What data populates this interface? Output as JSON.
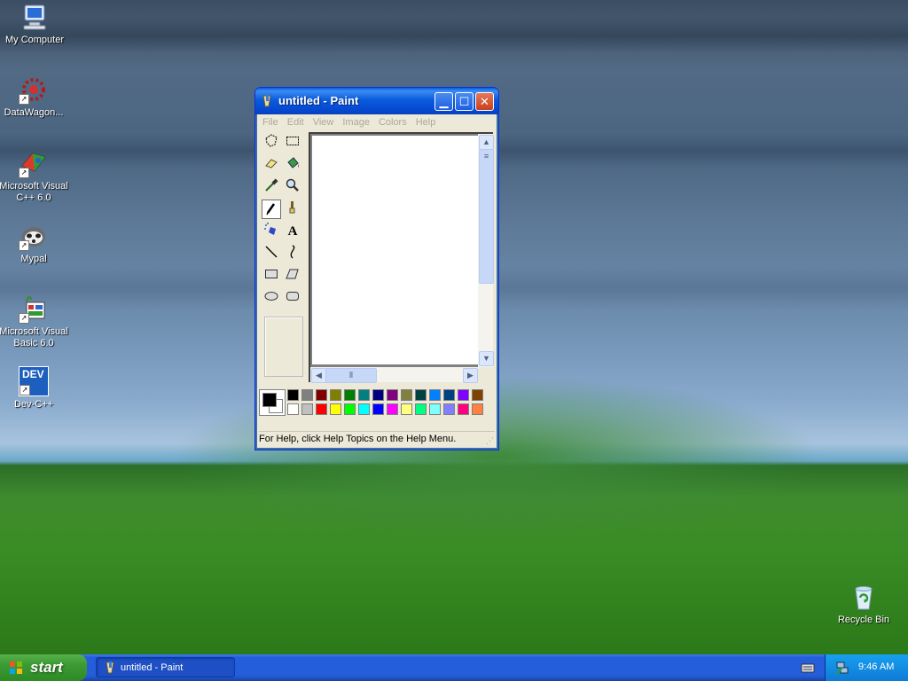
{
  "desktop": {
    "icons": [
      {
        "label": "My Computer",
        "icon": "my-computer-icon"
      },
      {
        "label": "DataWagon...",
        "icon": "datawagon-icon"
      },
      {
        "label": "Microsoft Visual C++ 6.0",
        "icon": "visual-cpp-icon"
      },
      {
        "label": "Mypal",
        "icon": "mypal-icon"
      },
      {
        "label": "Microsoft Visual Basic 6.0",
        "icon": "visual-basic-icon"
      },
      {
        "label": "Dev-C++",
        "icon": "dev-cpp-icon"
      }
    ],
    "recycle_bin": {
      "label": "Recycle Bin",
      "icon": "recycle-bin-icon"
    },
    "devcpp_badge": "DEV"
  },
  "paint_window": {
    "title": "untitled - Paint",
    "menu": [
      "File",
      "Edit",
      "View",
      "Image",
      "Colors",
      "Help"
    ],
    "tools": [
      "free-form-select",
      "select",
      "eraser",
      "fill-with-color",
      "pick-color",
      "magnifier",
      "pencil",
      "brush",
      "airbrush",
      "text",
      "line",
      "curve",
      "rectangle",
      "polygon",
      "ellipse",
      "rounded-rectangle"
    ],
    "active_tool": "pencil",
    "text_tool_glyph": "A",
    "status_text": "For Help, click Help Topics on the Help Menu.",
    "palette_top": [
      "#000000",
      "#808080",
      "#800000",
      "#808000",
      "#008000",
      "#008080",
      "#000080",
      "#800080",
      "#808040",
      "#004040",
      "#0080ff",
      "#004080",
      "#8000ff",
      "#804000"
    ],
    "palette_bottom": [
      "#ffffff",
      "#c0c0c0",
      "#ff0000",
      "#ffff00",
      "#00ff00",
      "#00ffff",
      "#0000ff",
      "#ff00ff",
      "#ffff80",
      "#00ff80",
      "#80ffff",
      "#8080ff",
      "#ff0080",
      "#ff8040"
    ],
    "foreground_color": "#000000",
    "background_color": "#ffffff"
  },
  "taskbar": {
    "start_label": "start",
    "items": [
      {
        "label": "untitled - Paint"
      }
    ],
    "clock": "9:46 AM"
  }
}
